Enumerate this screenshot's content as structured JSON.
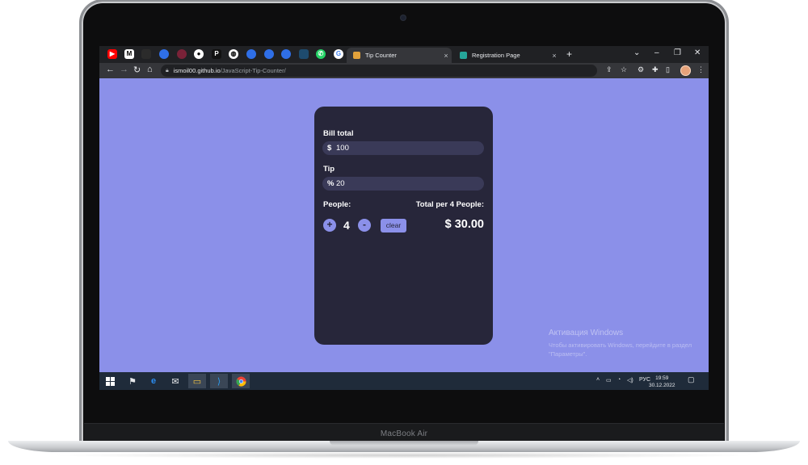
{
  "device": {
    "brand_label": "MacBook Air"
  },
  "browser": {
    "tabs": [
      {
        "title": "Tip Counter",
        "active": true
      },
      {
        "title": "Registration Page",
        "active": false
      }
    ],
    "tab_close": "×",
    "new_tab": "+",
    "window_controls": {
      "minimize": "–",
      "restore": "❐",
      "close": "✕",
      "tab_search": "⌄"
    },
    "url": {
      "host": "ismoil00.github.io",
      "path": "/JavaScript-Tip-Counter/"
    }
  },
  "app": {
    "bill_label": "Bill total",
    "bill_symbol": "$",
    "bill_value": "100",
    "tip_label": "Tip",
    "tip_symbol": "%",
    "tip_value": "20",
    "people_label": "People:",
    "total_label": "Total per 4 People:",
    "increment_label": "+",
    "decrement_label": "-",
    "people_count": "4",
    "clear_label": "clear",
    "total_value": "$ 30.00",
    "accent": "#8b90e9",
    "card_color": "#27263a"
  },
  "overlay": {
    "activation_title": "Активация Windows",
    "activation_text": "Чтобы активировать Windows, перейдите в раздел \"Параметры\"."
  },
  "taskbar": {
    "lang": "РУС",
    "time": "19:59",
    "date": "30.12.2022"
  }
}
